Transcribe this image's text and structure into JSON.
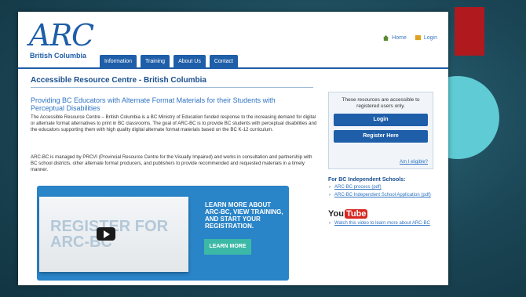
{
  "site": {
    "logo": {
      "name": "ARC",
      "subtitle": "British Columbia"
    },
    "top_links": {
      "home": "Home",
      "login": "Login"
    },
    "nav": [
      "Information",
      "Training",
      "About Us",
      "Contact"
    ],
    "page_title": "Accessible Resource Centre - British Columbia",
    "section_title": "Providing BC Educators with Alternate Format Materials for their Students with Perceptual Disabilities",
    "paragraphs": [
      "The Accessible Resource Centre – British Columbia is a BC Ministry of Education funded response to the increasing demand for digital or alternate format alternatives to print in BC classrooms. The goal of ARC-BC is to provide BC students with perceptual disabilities and the educators supporting them with high quality digital alternate format materials based on the BC K-12 curriculum.",
      "ARC-BC is managed by PRCVI (Provincial Resource Centre for the Visually Impaired) and works in consultation and partnership with BC school districts, other alternate format producers, and publishers to provide recommended and requested materials in a timely manner."
    ],
    "banner": {
      "register_text": "REGISTER FOR ARC-BC",
      "headline": "LEARN MORE ABOUT ARC-BC, VIEW TRAINING, AND START YOUR REGISTRATION.",
      "button": "LEARN MORE"
    },
    "sidebar": {
      "note": "These resources are accessible to registered users only.",
      "login_button": "Login",
      "register_button": "Register Here",
      "eligible_link": "Am I eligible?",
      "independent_heading": "For BC Independent Schools:",
      "independent_links": [
        "ARC-BC process (pdf)",
        "ARC-BC Independent School Application (pdf)"
      ],
      "youtube": {
        "you": "You",
        "tube": "Tube"
      },
      "video_link": "Watch this video to learn more about ARC-BC"
    }
  },
  "colors": {
    "accent": "#1f5ea8",
    "slide_red": "#b0191e",
    "slide_teal": "#5fcbd4",
    "banner_blue": "#2a84c8",
    "learn_green": "#3cb9a6"
  }
}
